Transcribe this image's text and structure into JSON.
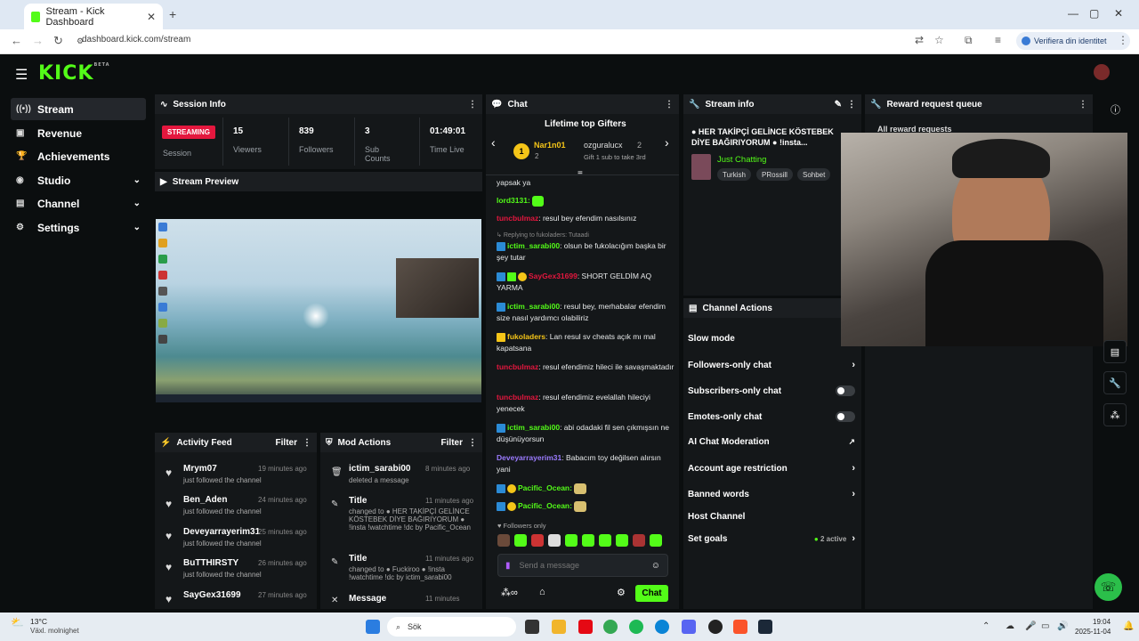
{
  "browser": {
    "tab_title": "Stream - Kick Dashboard",
    "url": "dashboard.kick.com/stream",
    "verify_label": "Verifiera din identitet"
  },
  "brand": {
    "logo": "KICK",
    "logo_sup": "BETA",
    "accent": "#53fc18"
  },
  "sidebar": {
    "items": [
      {
        "label": "Stream",
        "icon": "stream-icon"
      },
      {
        "label": "Revenue",
        "icon": "revenue-icon"
      },
      {
        "label": "Achievements",
        "icon": "trophy-icon"
      },
      {
        "label": "Studio",
        "icon": "studio-icon"
      },
      {
        "label": "Channel",
        "icon": "channel-icon"
      },
      {
        "label": "Settings",
        "icon": "gear-icon"
      }
    ]
  },
  "session": {
    "title": "Session Info",
    "status": "STREAMING",
    "status_label": "Session",
    "stats": [
      {
        "value": "15",
        "label": "Viewers"
      },
      {
        "value": "839",
        "label": "Followers"
      },
      {
        "value": "3",
        "label": "Sub Counts"
      },
      {
        "value": "01:49:01",
        "label": "Time Live"
      }
    ]
  },
  "preview": {
    "title": "Stream Preview"
  },
  "activity": {
    "title": "Activity Feed",
    "filter": "Filter",
    "items": [
      {
        "name": "Mrym07",
        "time": "19 minutes ago",
        "sub": "just followed the channel"
      },
      {
        "name": "Ben_Aden",
        "time": "24 minutes ago",
        "sub": "just followed the channel"
      },
      {
        "name": "Deveyarrayerim31",
        "time": "25 minutes ago",
        "sub": "just followed the channel"
      },
      {
        "name": "BuTTHIRSTY",
        "time": "26 minutes ago",
        "sub": "just followed the channel"
      },
      {
        "name": "SayGex31699",
        "time": "27 minutes ago",
        "sub": ""
      }
    ]
  },
  "mod": {
    "title": "Mod Actions",
    "filter": "Filter",
    "items": [
      {
        "name": "ictim_sarabi00",
        "time": "8 minutes ago",
        "sub": "deleted a message"
      },
      {
        "name": "Title",
        "time": "11 minutes ago",
        "sub": "changed to ● HER TAKİPÇİ GELİNCE KÖSTEBEK DİYE BAĞIRIYORUM ● !insta !watchtime !dc by Pacific_Ocean"
      },
      {
        "name": "Title",
        "time": "11 minutes ago",
        "sub": "changed to ● Fuckiroo ● !insta !watchtime !dc by ictim_sarabi00"
      },
      {
        "name": "Message",
        "time": "11 minutes",
        "sub": ""
      }
    ]
  },
  "chat": {
    "title": "Chat",
    "gifters_title": "Lifetime top Gifters",
    "gifter1_name": "Nar1n01",
    "gifter1_count": "2",
    "gifter2_name": "ozguralucx",
    "gifter2_count": "2",
    "gift_hint": "Gift 1 sub to take 3rd",
    "messages": [
      {
        "user": "",
        "text": "yapsak ya",
        "color": ""
      },
      {
        "user": "lord3131:",
        "text": "",
        "color": "g"
      },
      {
        "user": "tuncbulmaz",
        "text": ": resul bey efendim nasılsınız",
        "color": "r"
      },
      {
        "user": "",
        "text": "Replying to fukoladers: Tutaadi",
        "color": "reply"
      },
      {
        "user": "ictim_sarabi00",
        "text": ": olsun be fukolacığım başka bir şey tutar",
        "color": "g"
      },
      {
        "user": "SayGex31699",
        "text": ": SHORT GELDİM AQ YARMA",
        "color": "r"
      },
      {
        "user": "ictim_sarabi00",
        "text": ": resul bey, merhabalar efendim size nasıl yardımcı olabiliriz",
        "color": "g"
      },
      {
        "user": "fukoladers",
        "text": ": Lan resul sv cheats açık mı mal kapatsana",
        "color": "y"
      },
      {
        "user": "tuncbulmaz",
        "text": ": resul efendimiz hileci ile savaşmaktadır",
        "color": "r"
      },
      {
        "user": "tuncbulmaz",
        "text": ": resul efendimiz evelallah hileciyi yenecek",
        "color": "r"
      },
      {
        "user": "ictim_sarabi00",
        "text": ": abi odadaki fil sen çıkmışsın ne düşünüyorsun",
        "color": "g"
      },
      {
        "user": "Deveyarrayerim31",
        "text": ": Babacım toy değilsen alırsın yani",
        "color": "p"
      },
      {
        "user": "Pacific_Ocean:",
        "text": "",
        "color": "g"
      },
      {
        "user": "Pacific_Ocean:",
        "text": "",
        "color": "g"
      }
    ],
    "followers_only": "Followers only",
    "placeholder": "Send a message",
    "send": "Chat"
  },
  "stream_info": {
    "title": "Stream info",
    "stream_title": "● HER TAKİPÇİ GELİNCE KÖSTEBEK DİYE BAĞIRIYORUM ● !insta...",
    "category": "Just Chatting",
    "tags": [
      "Turkish",
      "PRossill",
      "Sohbet"
    ]
  },
  "channel_actions": {
    "title": "Channel Actions",
    "items": [
      {
        "label": "Slow mode",
        "control": "none"
      },
      {
        "label": "Followers-only chat",
        "control": "chevron"
      },
      {
        "label": "Subscribers-only chat",
        "control": "toggle"
      },
      {
        "label": "Emotes-only chat",
        "control": "toggle"
      },
      {
        "label": "AI Chat Moderation",
        "control": "external"
      },
      {
        "label": "Account age restriction",
        "control": "chevron"
      },
      {
        "label": "Banned words",
        "control": "chevron"
      },
      {
        "label": "Host Channel",
        "control": "none"
      },
      {
        "label": "Set goals",
        "control": "chevron",
        "extra": "2 active"
      }
    ]
  },
  "reward": {
    "title": "Reward request queue",
    "all": "All reward requests"
  },
  "taskbar": {
    "weather_temp": "13°C",
    "weather_desc": "Växl. molnighet",
    "search": "Sök",
    "time": "19:04",
    "date": "2025-11-04"
  }
}
